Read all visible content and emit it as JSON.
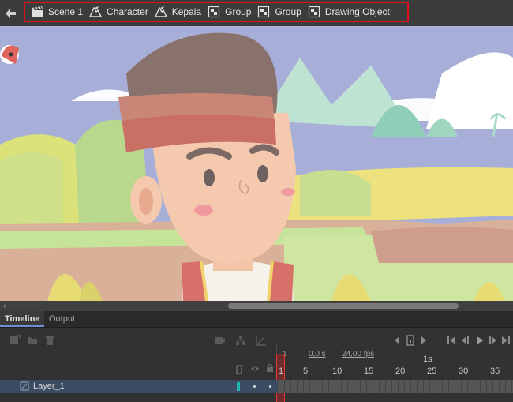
{
  "breadcrumb": {
    "items": [
      {
        "label": "Scene 1",
        "icon": "clapperboard-icon"
      },
      {
        "label": "Character",
        "icon": "graphic-symbol-icon"
      },
      {
        "label": "Kepala",
        "icon": "graphic-symbol-icon"
      },
      {
        "label": "Group",
        "icon": "group-icon"
      },
      {
        "label": "Group",
        "icon": "group-icon"
      },
      {
        "label": "Drawing Object",
        "icon": "drawing-object-icon"
      }
    ],
    "highlight_color": "#e1111b"
  },
  "timeline": {
    "tabs": [
      "Timeline",
      "Output"
    ],
    "active_tab": "Timeline",
    "current_frame": "1",
    "elapsed_time": "0,0 s",
    "frame_rate": "24,00 fps",
    "ruler_second_label": "1s",
    "ruler_labels": [
      "1",
      "5",
      "10",
      "15",
      "20",
      "25",
      "30",
      "35"
    ]
  },
  "layers": [
    {
      "name": "Layer_1",
      "color": "#22b3b3"
    }
  ]
}
